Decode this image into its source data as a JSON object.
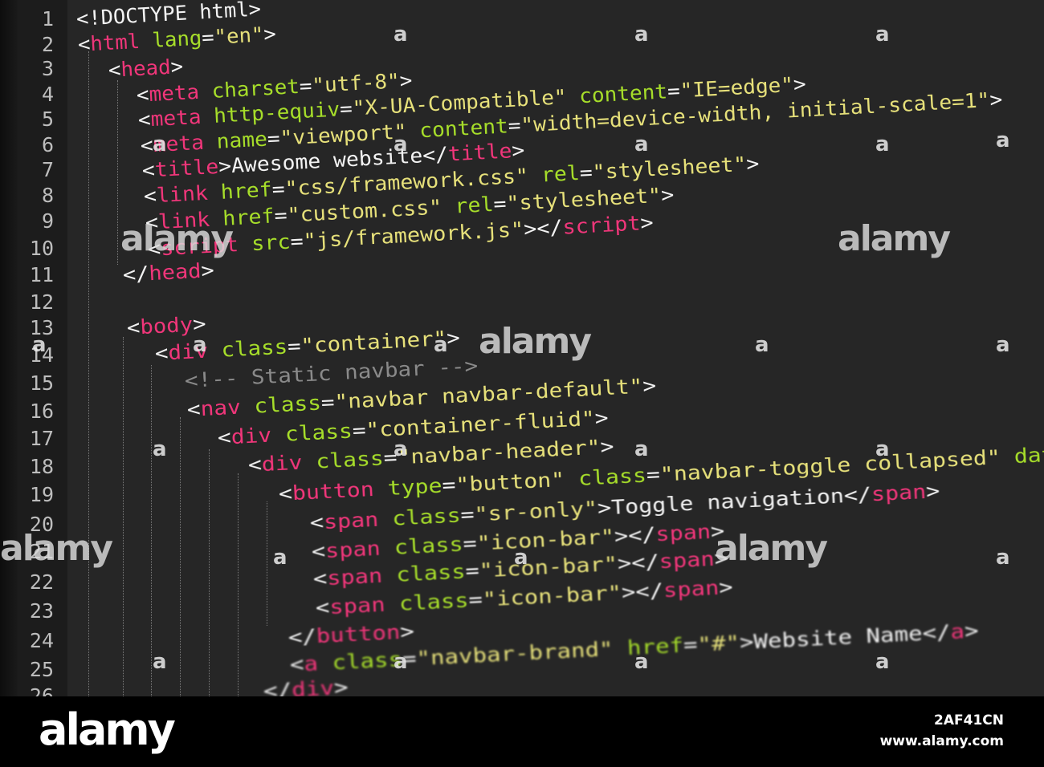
{
  "editor": {
    "line_numbers": [
      "1",
      "2",
      "3",
      "4",
      "5",
      "6",
      "7",
      "8",
      "9",
      "10",
      "11",
      "12",
      "13",
      "14",
      "15",
      "16",
      "17",
      "18",
      "19",
      "20",
      "21",
      "22",
      "23",
      "24",
      "25",
      "26"
    ],
    "lines": [
      {
        "indent": 0,
        "parts": [
          {
            "t": "<!DOCTYPE html>",
            "c": "plain"
          }
        ]
      },
      {
        "indent": 0,
        "parts": [
          {
            "t": "<",
            "c": "plain"
          },
          {
            "t": "html",
            "c": "tag"
          },
          {
            "t": " ",
            "c": "plain"
          },
          {
            "t": "lang",
            "c": "attr"
          },
          {
            "t": "=",
            "c": "plain"
          },
          {
            "t": "\"en\"",
            "c": "str"
          },
          {
            "t": ">",
            "c": "plain"
          }
        ]
      },
      {
        "indent": 1,
        "parts": [
          {
            "t": "<",
            "c": "plain"
          },
          {
            "t": "head",
            "c": "tag"
          },
          {
            "t": ">",
            "c": "plain"
          }
        ]
      },
      {
        "indent": 2,
        "parts": [
          {
            "t": "<",
            "c": "plain"
          },
          {
            "t": "meta",
            "c": "tag"
          },
          {
            "t": " ",
            "c": "plain"
          },
          {
            "t": "charset",
            "c": "attr"
          },
          {
            "t": "=",
            "c": "plain"
          },
          {
            "t": "\"utf-8\"",
            "c": "str"
          },
          {
            "t": ">",
            "c": "plain"
          }
        ]
      },
      {
        "indent": 2,
        "parts": [
          {
            "t": "<",
            "c": "plain"
          },
          {
            "t": "meta",
            "c": "tag"
          },
          {
            "t": " ",
            "c": "plain"
          },
          {
            "t": "http-equiv",
            "c": "attr"
          },
          {
            "t": "=",
            "c": "plain"
          },
          {
            "t": "\"X-UA-Compatible\"",
            "c": "str"
          },
          {
            "t": " ",
            "c": "plain"
          },
          {
            "t": "content",
            "c": "attr"
          },
          {
            "t": "=",
            "c": "plain"
          },
          {
            "t": "\"IE=edge\"",
            "c": "str"
          },
          {
            "t": ">",
            "c": "plain"
          }
        ]
      },
      {
        "indent": 2,
        "parts": [
          {
            "t": "<",
            "c": "plain"
          },
          {
            "t": "meta",
            "c": "tag"
          },
          {
            "t": " ",
            "c": "plain"
          },
          {
            "t": "name",
            "c": "attr"
          },
          {
            "t": "=",
            "c": "plain"
          },
          {
            "t": "\"viewport\"",
            "c": "str"
          },
          {
            "t": " ",
            "c": "plain"
          },
          {
            "t": "content",
            "c": "attr"
          },
          {
            "t": "=",
            "c": "plain"
          },
          {
            "t": "\"width=device-width, initial-scale=1\"",
            "c": "str"
          },
          {
            "t": ">",
            "c": "plain"
          }
        ]
      },
      {
        "indent": 2,
        "parts": [
          {
            "t": "<",
            "c": "plain"
          },
          {
            "t": "title",
            "c": "tag"
          },
          {
            "t": ">Awesome website</",
            "c": "plain"
          },
          {
            "t": "title",
            "c": "tag"
          },
          {
            "t": ">",
            "c": "plain"
          }
        ]
      },
      {
        "indent": 2,
        "parts": [
          {
            "t": "<",
            "c": "plain"
          },
          {
            "t": "link",
            "c": "tag"
          },
          {
            "t": " ",
            "c": "plain"
          },
          {
            "t": "href",
            "c": "attr"
          },
          {
            "t": "=",
            "c": "plain"
          },
          {
            "t": "\"css/framework.css\"",
            "c": "str"
          },
          {
            "t": " ",
            "c": "plain"
          },
          {
            "t": "rel",
            "c": "attr"
          },
          {
            "t": "=",
            "c": "plain"
          },
          {
            "t": "\"stylesheet\"",
            "c": "str"
          },
          {
            "t": ">",
            "c": "plain"
          }
        ]
      },
      {
        "indent": 2,
        "parts": [
          {
            "t": "<",
            "c": "plain"
          },
          {
            "t": "link",
            "c": "tag"
          },
          {
            "t": " ",
            "c": "plain"
          },
          {
            "t": "href",
            "c": "attr"
          },
          {
            "t": "=",
            "c": "plain"
          },
          {
            "t": "\"custom.css\"",
            "c": "str"
          },
          {
            "t": " ",
            "c": "plain"
          },
          {
            "t": "rel",
            "c": "attr"
          },
          {
            "t": "=",
            "c": "plain"
          },
          {
            "t": "\"stylesheet\"",
            "c": "str"
          },
          {
            "t": ">",
            "c": "plain"
          }
        ]
      },
      {
        "indent": 2,
        "parts": [
          {
            "t": "<",
            "c": "plain"
          },
          {
            "t": "script",
            "c": "tag"
          },
          {
            "t": " ",
            "c": "plain"
          },
          {
            "t": "src",
            "c": "attr"
          },
          {
            "t": "=",
            "c": "plain"
          },
          {
            "t": "\"js/framework.js\"",
            "c": "str"
          },
          {
            "t": "></",
            "c": "plain"
          },
          {
            "t": "script",
            "c": "tag"
          },
          {
            "t": ">",
            "c": "plain"
          }
        ]
      },
      {
        "indent": 1,
        "parts": [
          {
            "t": "</",
            "c": "plain"
          },
          {
            "t": "head",
            "c": "tag"
          },
          {
            "t": ">",
            "c": "plain"
          }
        ]
      },
      {
        "indent": 0,
        "parts": []
      },
      {
        "indent": 1,
        "parts": [
          {
            "t": "<",
            "c": "plain"
          },
          {
            "t": "body",
            "c": "tag"
          },
          {
            "t": ">",
            "c": "plain"
          }
        ]
      },
      {
        "indent": 2,
        "parts": [
          {
            "t": "<",
            "c": "plain"
          },
          {
            "t": "div",
            "c": "tag"
          },
          {
            "t": " ",
            "c": "plain"
          },
          {
            "t": "class",
            "c": "attr"
          },
          {
            "t": "=",
            "c": "plain"
          },
          {
            "t": "\"container\"",
            "c": "str"
          },
          {
            "t": ">",
            "c": "plain"
          }
        ]
      },
      {
        "indent": 3,
        "parts": [
          {
            "t": "<!-- Static navbar -->",
            "c": "cmt"
          }
        ]
      },
      {
        "indent": 3,
        "parts": [
          {
            "t": "<",
            "c": "plain"
          },
          {
            "t": "nav",
            "c": "tag"
          },
          {
            "t": " ",
            "c": "plain"
          },
          {
            "t": "class",
            "c": "attr"
          },
          {
            "t": "=",
            "c": "plain"
          },
          {
            "t": "\"navbar navbar-default\"",
            "c": "str"
          },
          {
            "t": ">",
            "c": "plain"
          }
        ]
      },
      {
        "indent": 4,
        "parts": [
          {
            "t": "<",
            "c": "plain"
          },
          {
            "t": "div",
            "c": "tag"
          },
          {
            "t": " ",
            "c": "plain"
          },
          {
            "t": "class",
            "c": "attr"
          },
          {
            "t": "=",
            "c": "plain"
          },
          {
            "t": "\"container-fluid\"",
            "c": "str"
          },
          {
            "t": ">",
            "c": "plain"
          }
        ]
      },
      {
        "indent": 5,
        "parts": [
          {
            "t": "<",
            "c": "plain"
          },
          {
            "t": "div",
            "c": "tag"
          },
          {
            "t": " ",
            "c": "plain"
          },
          {
            "t": "class",
            "c": "attr"
          },
          {
            "t": "=",
            "c": "plain"
          },
          {
            "t": "\"navbar-header\"",
            "c": "str"
          },
          {
            "t": ">",
            "c": "plain"
          }
        ]
      },
      {
        "indent": 6,
        "parts": [
          {
            "t": "<",
            "c": "plain"
          },
          {
            "t": "button",
            "c": "tag"
          },
          {
            "t": " ",
            "c": "plain"
          },
          {
            "t": "type",
            "c": "attr"
          },
          {
            "t": "=",
            "c": "plain"
          },
          {
            "t": "\"button\"",
            "c": "str"
          },
          {
            "t": " ",
            "c": "plain"
          },
          {
            "t": "class",
            "c": "attr"
          },
          {
            "t": "=",
            "c": "plain"
          },
          {
            "t": "\"navbar-toggle collapsed\"",
            "c": "str"
          },
          {
            "t": " ",
            "c": "plain"
          },
          {
            "t": "data-tog",
            "c": "attr"
          }
        ]
      },
      {
        "indent": 7,
        "parts": [
          {
            "t": "<",
            "c": "plain"
          },
          {
            "t": "span",
            "c": "tag"
          },
          {
            "t": " ",
            "c": "plain"
          },
          {
            "t": "class",
            "c": "attr"
          },
          {
            "t": "=",
            "c": "plain"
          },
          {
            "t": "\"sr-only\"",
            "c": "str"
          },
          {
            "t": ">Toggle navigation</",
            "c": "plain"
          },
          {
            "t": "span",
            "c": "tag"
          },
          {
            "t": ">",
            "c": "plain"
          }
        ]
      },
      {
        "indent": 7,
        "parts": [
          {
            "t": "<",
            "c": "plain"
          },
          {
            "t": "span",
            "c": "tag"
          },
          {
            "t": " ",
            "c": "plain"
          },
          {
            "t": "class",
            "c": "attr"
          },
          {
            "t": "=",
            "c": "plain"
          },
          {
            "t": "\"icon-bar\"",
            "c": "str"
          },
          {
            "t": "></",
            "c": "plain"
          },
          {
            "t": "span",
            "c": "tag"
          },
          {
            "t": ">",
            "c": "plain"
          }
        ]
      },
      {
        "indent": 7,
        "parts": [
          {
            "t": "<",
            "c": "plain"
          },
          {
            "t": "span",
            "c": "tag"
          },
          {
            "t": " ",
            "c": "plain"
          },
          {
            "t": "class",
            "c": "attr"
          },
          {
            "t": "=",
            "c": "plain"
          },
          {
            "t": "\"icon-bar\"",
            "c": "str"
          },
          {
            "t": "></",
            "c": "plain"
          },
          {
            "t": "span",
            "c": "tag"
          },
          {
            "t": ">",
            "c": "plain"
          }
        ]
      },
      {
        "indent": 7,
        "parts": [
          {
            "t": "<",
            "c": "plain"
          },
          {
            "t": "span",
            "c": "tag"
          },
          {
            "t": " ",
            "c": "plain"
          },
          {
            "t": "class",
            "c": "attr"
          },
          {
            "t": "=",
            "c": "plain"
          },
          {
            "t": "\"icon-bar\"",
            "c": "str"
          },
          {
            "t": "></",
            "c": "plain"
          },
          {
            "t": "span",
            "c": "tag"
          },
          {
            "t": ">",
            "c": "plain"
          }
        ]
      },
      {
        "indent": 6,
        "parts": [
          {
            "t": "</",
            "c": "plain"
          },
          {
            "t": "button",
            "c": "tag"
          },
          {
            "t": ">",
            "c": "plain"
          }
        ]
      },
      {
        "indent": 6,
        "parts": [
          {
            "t": "<",
            "c": "plain"
          },
          {
            "t": "a",
            "c": "tag"
          },
          {
            "t": " ",
            "c": "plain"
          },
          {
            "t": "class",
            "c": "attr"
          },
          {
            "t": "=",
            "c": "plain"
          },
          {
            "t": "\"navbar-brand\"",
            "c": "str"
          },
          {
            "t": " ",
            "c": "plain"
          },
          {
            "t": "href",
            "c": "attr"
          },
          {
            "t": "=",
            "c": "plain"
          },
          {
            "t": "\"#\"",
            "c": "str"
          },
          {
            "t": ">Website Name</",
            "c": "plain"
          },
          {
            "t": "a",
            "c": "tag"
          },
          {
            "t": ">",
            "c": "plain"
          }
        ]
      },
      {
        "indent": 5,
        "parts": [
          {
            "t": "</",
            "c": "plain"
          },
          {
            "t": "div",
            "c": "tag"
          },
          {
            "t": ">",
            "c": "plain"
          }
        ]
      }
    ]
  },
  "colors": {
    "background": "#262626",
    "gutter": "#1c1c1c",
    "tag": "#f0367a",
    "attribute": "#a6dd2a",
    "string": "#e6e07a",
    "comment": "#8a8a8a",
    "text": "#f3f3f3"
  },
  "watermark": {
    "brand": "alamy",
    "small_mark": "a"
  },
  "footer": {
    "logo": "alamy",
    "image_id": "2AF41CN",
    "site": "www.alamy.com"
  }
}
